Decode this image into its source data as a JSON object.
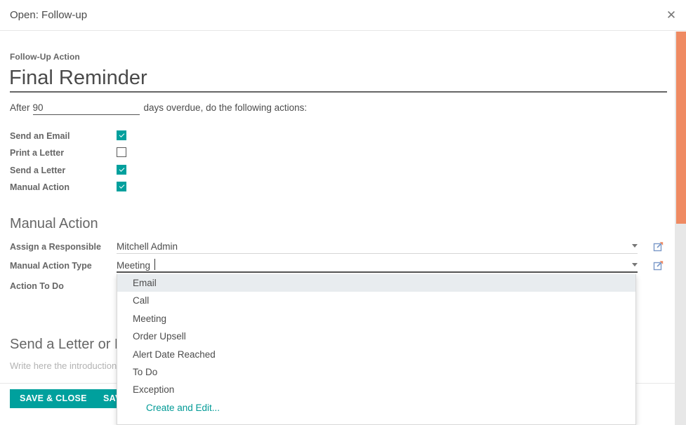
{
  "modal": {
    "title": "Open: Follow-up",
    "close_icon": "close-icon",
    "close_glyph": "✕"
  },
  "form": {
    "followup_action_label": "Follow-Up Action",
    "followup_action_name": "Final Reminder",
    "after_prefix": "After",
    "days_value": "90",
    "after_suffix": "days overdue, do the following actions:",
    "checkboxes": [
      {
        "label": "Send an Email",
        "checked": true
      },
      {
        "label": "Print a Letter",
        "checked": false
      },
      {
        "label": "Send a Letter",
        "checked": true
      },
      {
        "label": "Manual Action",
        "checked": true
      }
    ]
  },
  "manual_action": {
    "section_title": "Manual Action",
    "fields": [
      {
        "label": "Assign a Responsible",
        "value": "Mitchell Admin",
        "focused": false
      },
      {
        "label": "Manual Action Type",
        "value": "Meeting",
        "focused": true
      },
      {
        "label": "Action To Do",
        "value": "",
        "focused": false
      }
    ]
  },
  "autocomplete": {
    "items": [
      {
        "label": "Email",
        "active": true
      },
      {
        "label": "Call",
        "active": false
      },
      {
        "label": "Meeting",
        "active": false
      },
      {
        "label": "Order Upsell",
        "active": false
      },
      {
        "label": "Alert Date Reached",
        "active": false
      },
      {
        "label": "To Do",
        "active": false
      },
      {
        "label": "Exception",
        "active": false
      }
    ],
    "create_label": "Create and Edit..."
  },
  "letter_section": {
    "title": "Send a Letter or Email",
    "placeholder": "Write here the introduction of your letter or email"
  },
  "footer": {
    "save_close_label": "Save & Close",
    "save_new_label": "Save & New"
  },
  "colors": {
    "accent_teal": "#00a09d",
    "scrollbar_orange": "#ef8a62",
    "highlight": "#e8ecef"
  }
}
